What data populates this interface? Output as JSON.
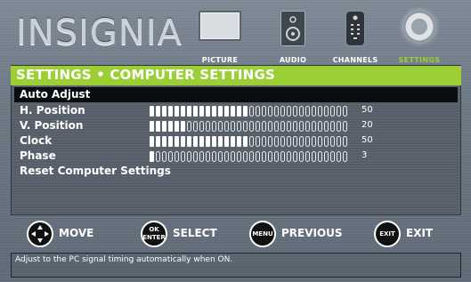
{
  "brand": "INSIGNIA",
  "nav": [
    {
      "label": "PICTURE",
      "icon": "tv-icon",
      "active": false
    },
    {
      "label": "AUDIO",
      "icon": "speaker-icon",
      "active": false
    },
    {
      "label": "CHANNELS",
      "icon": "remote-icon",
      "active": false
    },
    {
      "label": "SETTINGS",
      "icon": "gear-icon",
      "active": true
    }
  ],
  "menu": {
    "title": "SETTINGS • COMPUTER SETTINGS",
    "items": [
      {
        "label": "Auto Adjust",
        "selected": true
      },
      {
        "label": "H. Position",
        "value": "50",
        "level": 0.5
      },
      {
        "label": "V. Position",
        "value": "20",
        "level": 0.2
      },
      {
        "label": "Clock",
        "value": "50",
        "level": 0.5
      },
      {
        "label": "Phase",
        "value": "3",
        "level": 0.03
      },
      {
        "label": "Reset Computer Settings"
      }
    ]
  },
  "footer": {
    "move": {
      "label": "MOVE"
    },
    "select": {
      "key_top": "OK",
      "key_bottom": "ENTER",
      "label": "SELECT"
    },
    "previous": {
      "key": "MENU",
      "label": "PREVIOUS"
    },
    "exit": {
      "key": "EXIT",
      "label": "EXIT"
    }
  },
  "help_text": "Adjust to the PC signal timing automatically when ON.",
  "colors": {
    "accent": "#9ccf35",
    "selection": "#0b0c0d",
    "panel": "#555e68"
  }
}
